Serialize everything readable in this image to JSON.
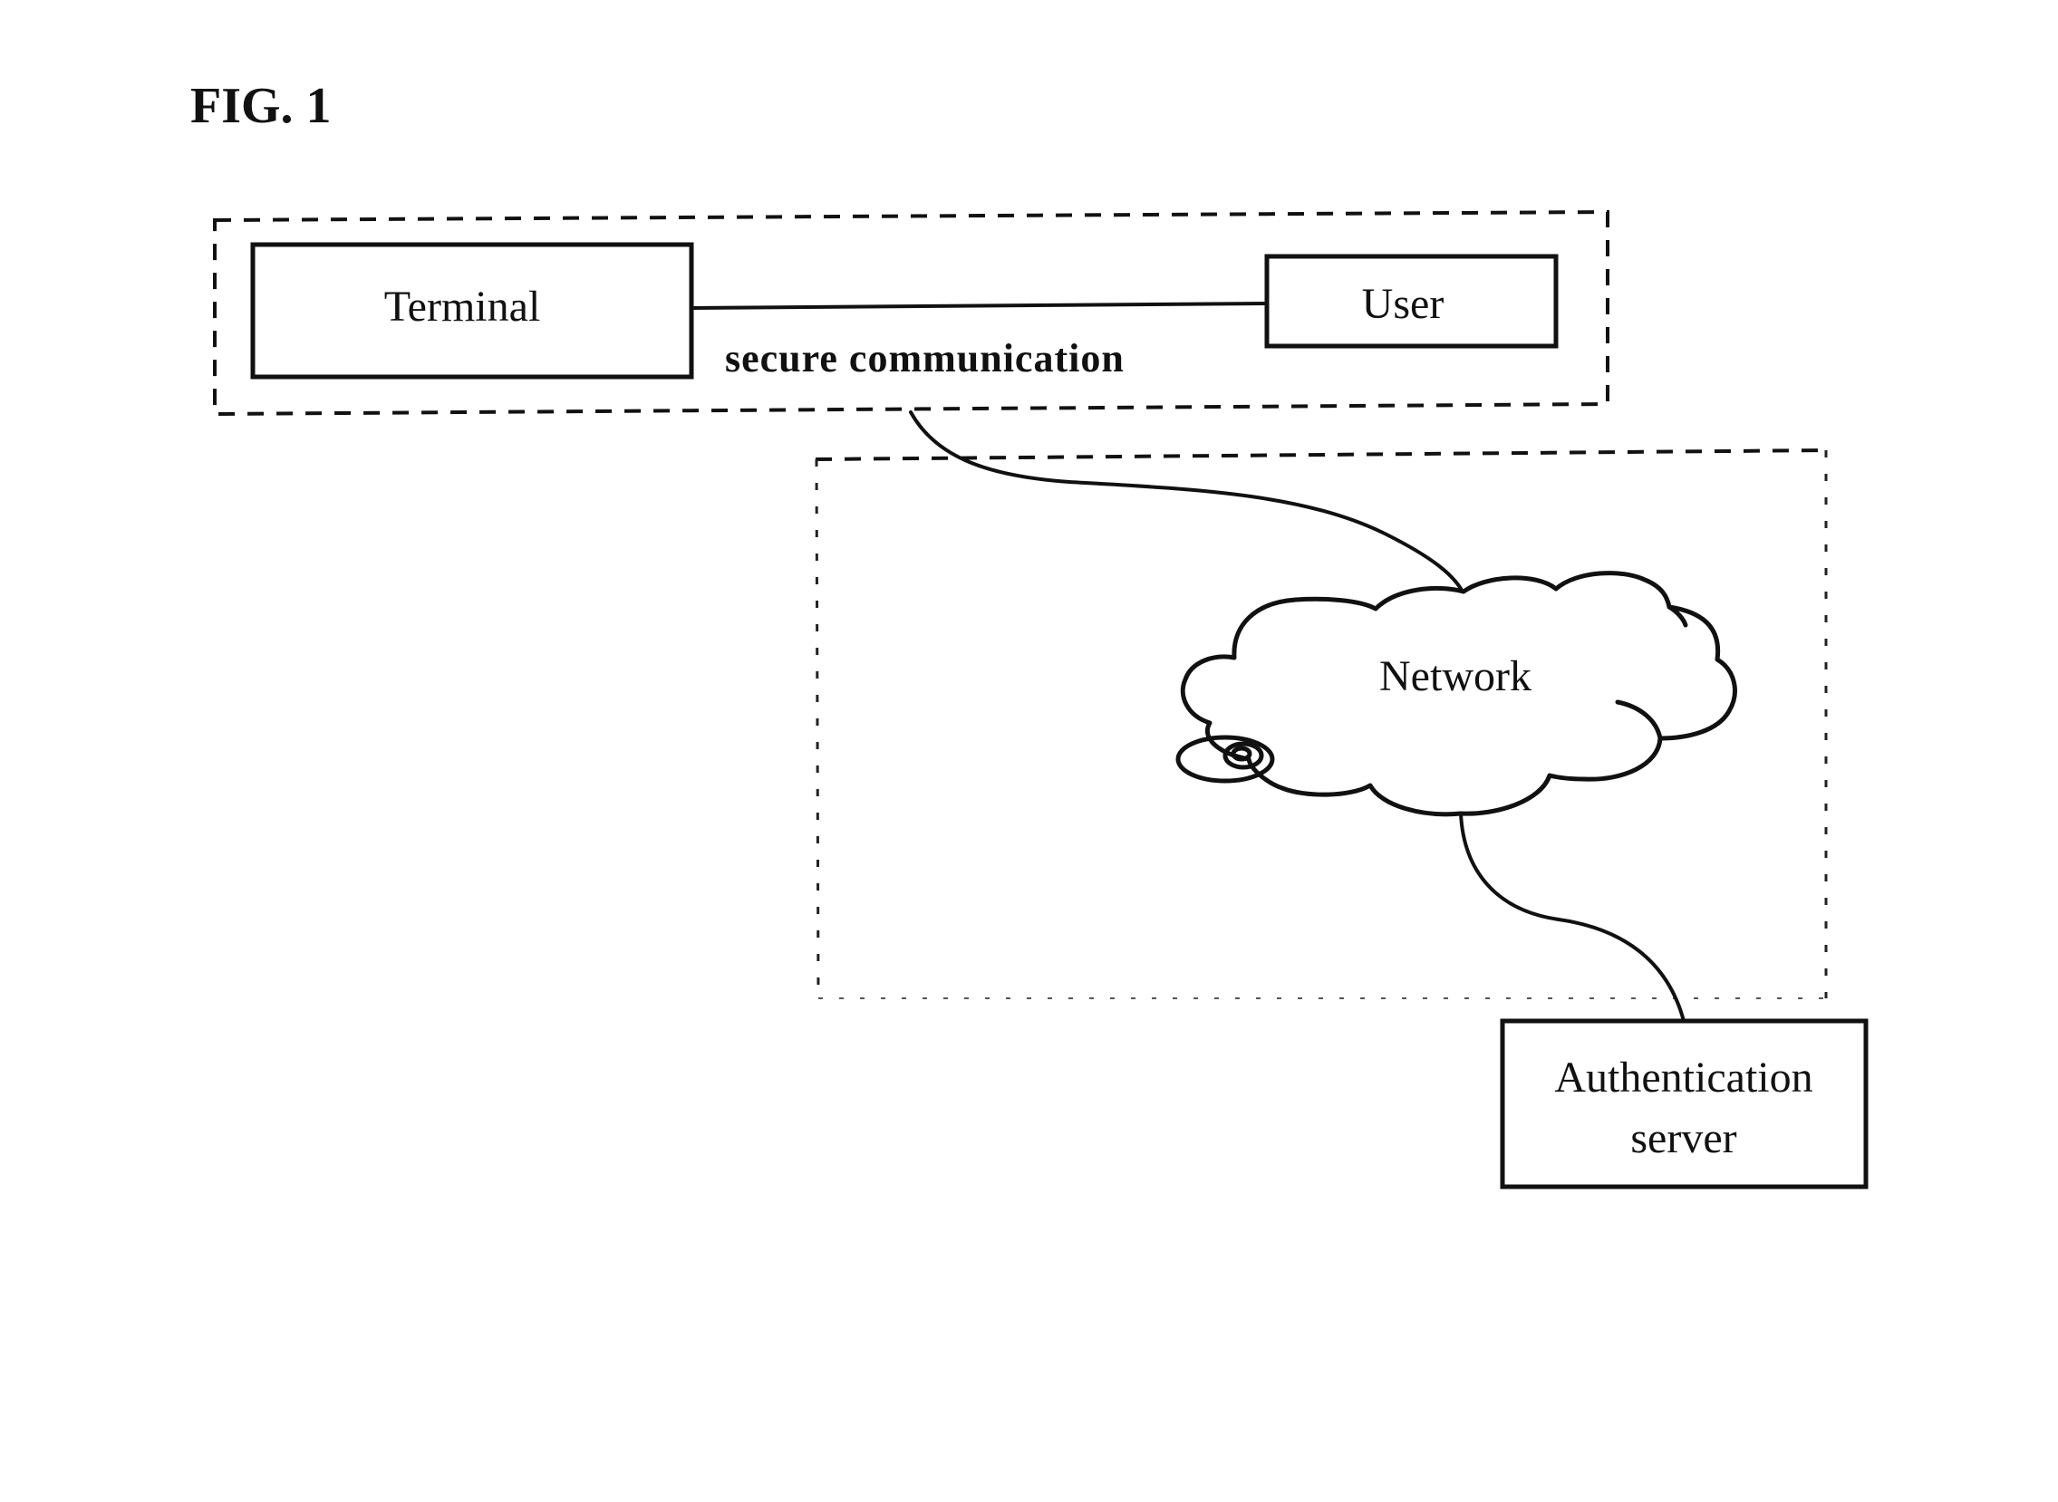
{
  "figure": {
    "title": "FIG. 1"
  },
  "nodes": {
    "terminal": {
      "label": "Terminal"
    },
    "user": {
      "label": "User"
    },
    "network": {
      "label": "Network"
    },
    "auth_server": {
      "label_line1": "Authentication",
      "label_line2": "server"
    }
  },
  "edges": {
    "terminal_user": {
      "label": "secure communication"
    },
    "group_to_network": {
      "label": ""
    },
    "network_to_auth_server": {
      "label": ""
    }
  },
  "groups": {
    "secure_zone": {
      "members": [
        "Terminal",
        "User"
      ],
      "border": "dashed"
    },
    "network_zone": {
      "members": [
        "Network"
      ],
      "border": "dotted"
    }
  },
  "colors": {
    "ink": "#111111",
    "background": "#ffffff"
  }
}
